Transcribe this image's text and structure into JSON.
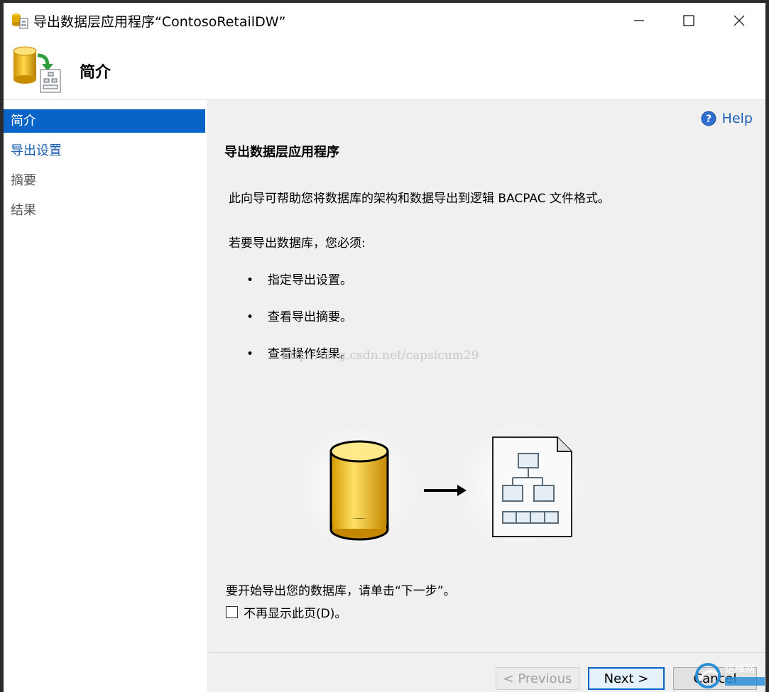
{
  "window": {
    "title": "导出数据层应用程序“ContosoRetailDW”"
  },
  "header": {
    "title": "简介"
  },
  "sidebar": {
    "items": [
      {
        "label": "简介",
        "state": "active"
      },
      {
        "label": "导出设置",
        "state": "link"
      },
      {
        "label": "摘要",
        "state": "disabled"
      },
      {
        "label": "结果",
        "state": "disabled"
      }
    ]
  },
  "content": {
    "help_label": "Help",
    "heading": "导出数据层应用程序",
    "description": "此向导可帮助您将数据库的架构和数据导出到逻辑 BACPAC 文件格式。",
    "must_intro": "若要导出数据库，您必须:",
    "bullets": [
      "指定导出设置。",
      "查看导出摘要。",
      "查看操作结果。"
    ],
    "watermark": "http://blog.csdn.net/capsicum29",
    "start_text": "要开始导出您的数据库，请单击“下一步”。",
    "checkbox_label": "不再显示此页(D)。",
    "checkbox_checked": false
  },
  "buttons": {
    "previous": "< Previous",
    "next": "Next >",
    "cancel": "Cancel"
  },
  "corner_logo": {
    "text": "运维网"
  },
  "colors": {
    "accent": "#0a64c8",
    "content_bg": "#f0f0f0",
    "link": "#1a5fb4"
  }
}
